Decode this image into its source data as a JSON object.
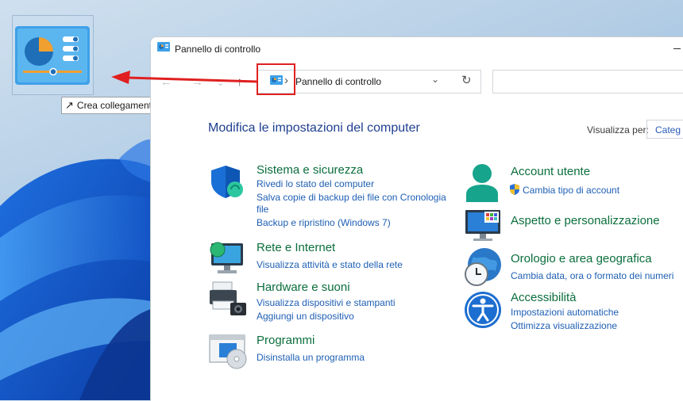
{
  "window": {
    "title": "Pannello di controllo"
  },
  "address": {
    "location": "Pannello di controllo"
  },
  "search": {
    "placeholder": ""
  },
  "header": {
    "title": "Modifica le impostazioni del computer",
    "view_by_label": "Visualizza per:",
    "view_by_value": "Categ"
  },
  "tooltip": {
    "text": "Crea collegamento in Desktop"
  },
  "categories_left": [
    {
      "title": "Sistema e sicurezza",
      "links": [
        "Rivedi lo stato del computer",
        "Salva copie di backup dei file con Cronologia",
        "file",
        "Backup e ripristino (Windows 7)"
      ]
    },
    {
      "title": "Rete e Internet",
      "links": [
        "Visualizza attività e stato della rete"
      ]
    },
    {
      "title": "Hardware e suoni",
      "links": [
        "Visualizza dispositivi e stampanti",
        "Aggiungi un dispositivo"
      ]
    },
    {
      "title": "Programmi",
      "links": [
        "Disinstalla un programma"
      ]
    }
  ],
  "categories_right": [
    {
      "title": "Account utente",
      "links": [
        "Cambia tipo di account"
      ]
    },
    {
      "title": "Aspetto e personalizzazione",
      "links": []
    },
    {
      "title": "Orologio e area geografica",
      "links": [
        "Cambia data, ora o formato dei numeri"
      ]
    },
    {
      "title": "Accessibilità",
      "links": [
        "Impostazioni automatiche",
        "Ottimizza visualizzazione"
      ]
    }
  ],
  "colors": {
    "accent": "#1e5fb4",
    "category_title": "#0b6e3c",
    "heading": "#1e3f8f",
    "highlight": "#e02020"
  }
}
